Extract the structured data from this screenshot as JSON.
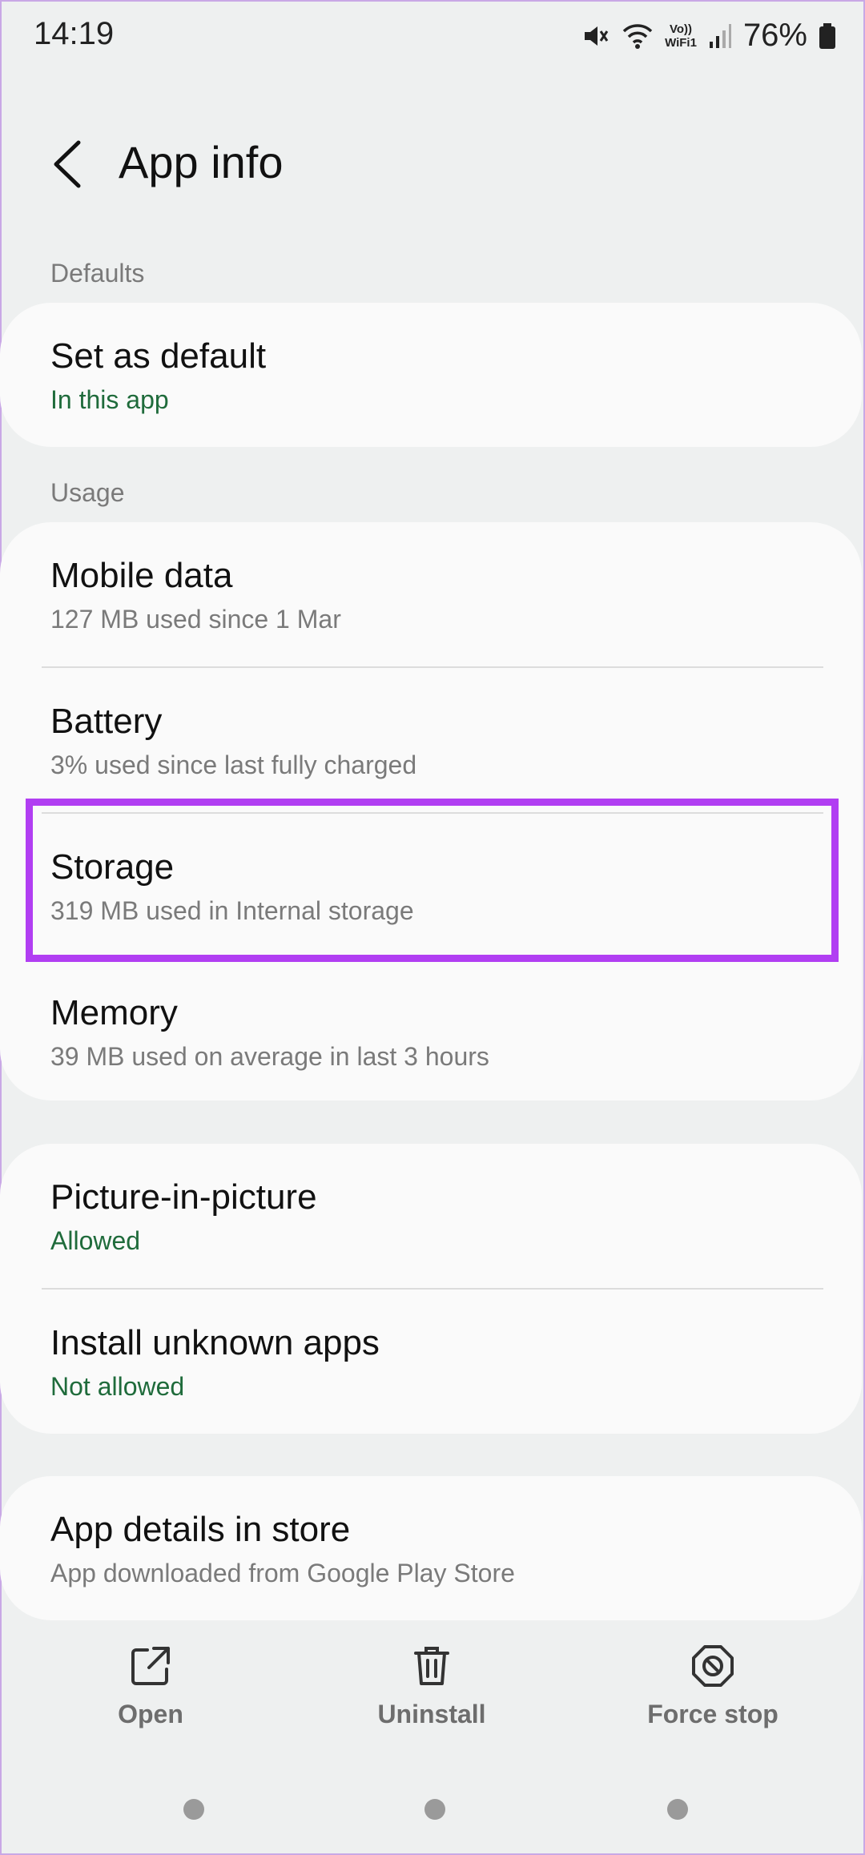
{
  "status_bar": {
    "time": "14:19",
    "battery": "76%",
    "volte_top": "Vo))",
    "volte_bottom": "WiFi1"
  },
  "header": {
    "title": "App info"
  },
  "sections": {
    "defaults_label": "Defaults",
    "usage_label": "Usage"
  },
  "defaults": {
    "set_as_default": {
      "title": "Set as default",
      "subtitle": "In this app"
    }
  },
  "usage": {
    "mobile_data": {
      "title": "Mobile data",
      "subtitle": "127 MB used since 1 Mar"
    },
    "battery": {
      "title": "Battery",
      "subtitle": "3% used since last fully charged"
    },
    "storage": {
      "title": "Storage",
      "subtitle": "319 MB used in Internal storage"
    },
    "memory": {
      "title": "Memory",
      "subtitle": "39 MB used on average in last 3 hours"
    }
  },
  "permissions": {
    "pip": {
      "title": "Picture-in-picture",
      "subtitle": "Allowed"
    },
    "unknown_apps": {
      "title": "Install unknown apps",
      "subtitle": "Not allowed"
    }
  },
  "store": {
    "details": {
      "title": "App details in store",
      "subtitle": "App downloaded from Google Play Store"
    }
  },
  "actions": {
    "open": "Open",
    "uninstall": "Uninstall",
    "force_stop": "Force stop"
  },
  "colors": {
    "highlight": "#b13ef2",
    "accent_green": "#1f6b3b",
    "background": "#eef0f0",
    "card": "#fafafa"
  }
}
